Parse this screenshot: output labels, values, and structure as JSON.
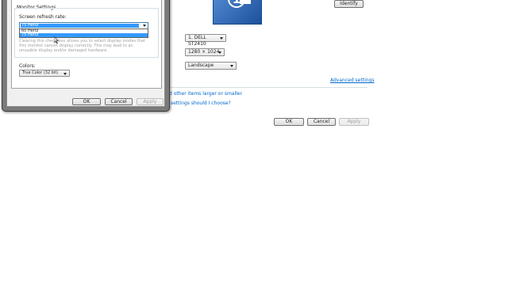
{
  "main": {
    "identify_label": "Identify",
    "monitor_number": "1",
    "display_select": "1. DELL ST2410",
    "resolution_select": "1280 × 1024",
    "orientation_select": "Landscape",
    "advanced_settings_link": "Advanced settings",
    "link_larger_text": "d other items larger or smaller",
    "link_settings_choose": "settings should I choose?",
    "ok_label": "OK",
    "cancel_label": "Cancel",
    "apply_label": "Apply"
  },
  "dialog": {
    "group_title": "Monitor Settings",
    "refresh_label": "Screen refresh rate:",
    "refresh_selected": "75 Hertz",
    "refresh_options": [
      "60 Hertz",
      "75 Hertz"
    ],
    "hide_modes_text": "Clearing this check box allows you to select display modes that this monitor cannot display correctly. This may lead to an unusable display and/or damaged hardware.",
    "colors_label": "Colors:",
    "colors_value": "True Color (32 bit)",
    "ok_label": "OK",
    "cancel_label": "Cancel",
    "apply_label": "Apply"
  },
  "colors": {
    "selection": "#3399ff",
    "link": "#0066cc",
    "monitor_screen": "#2a5ca8",
    "window_frame": "#4d4d4d"
  }
}
